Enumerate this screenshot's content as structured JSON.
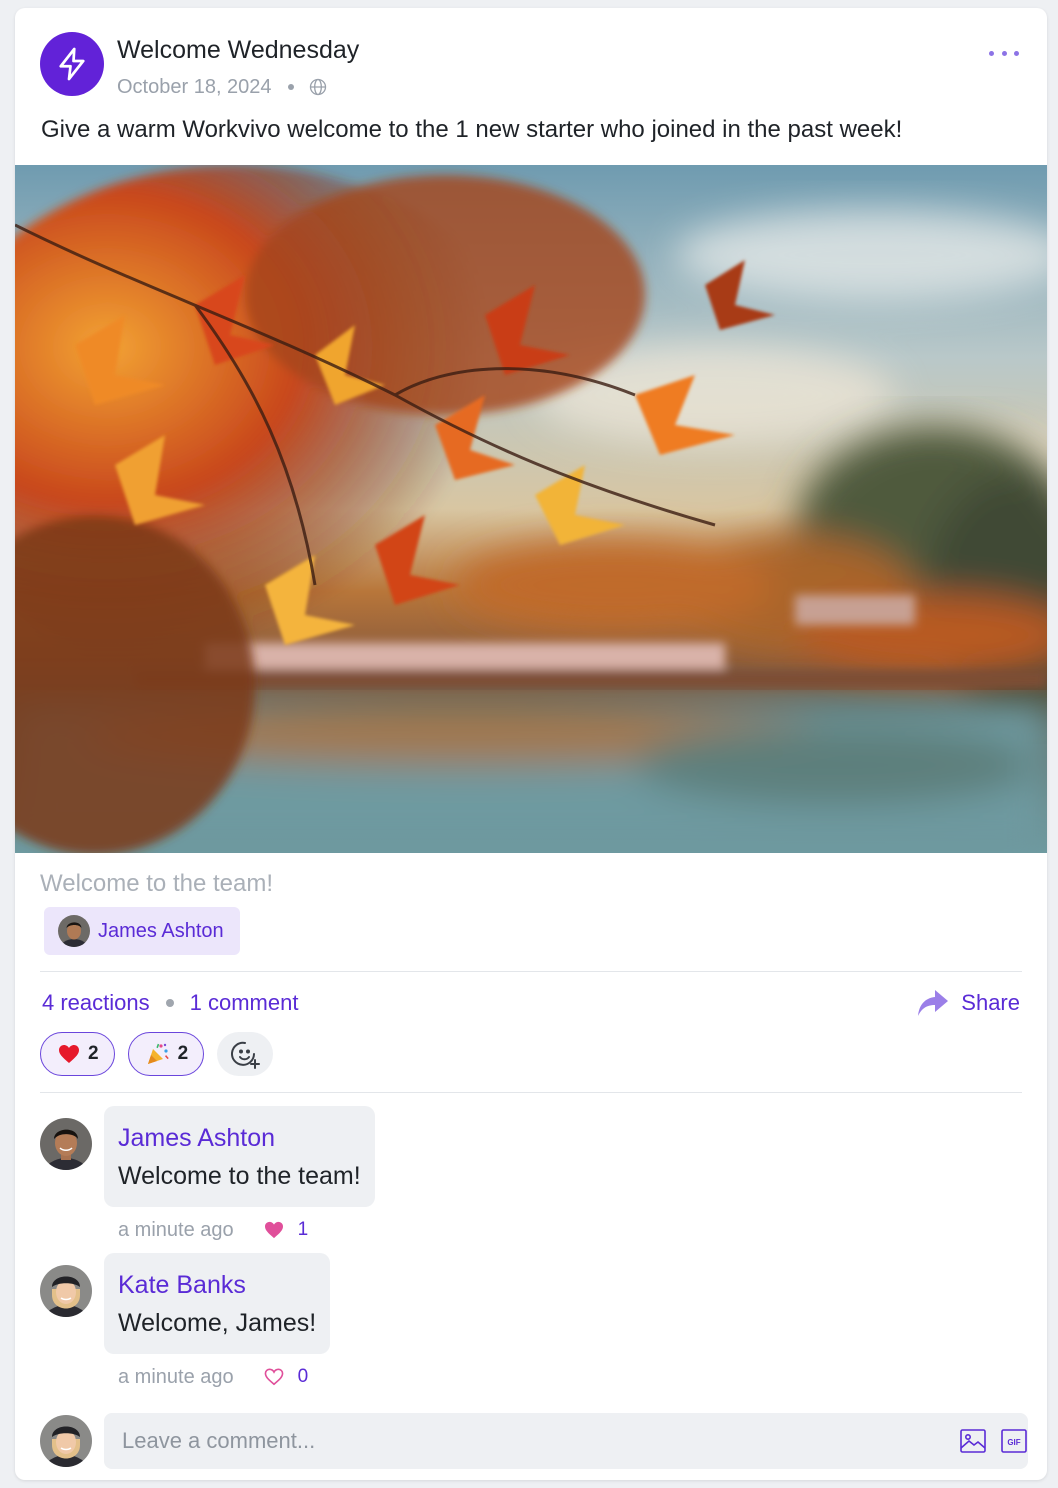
{
  "post": {
    "title": "Welcome Wednesday",
    "date": "October 18, 2024",
    "body": "Give a warm Workvivo welcome to the 1 new starter who joined in the past week!",
    "caption": "Welcome to the team!",
    "mention": "James Ashton"
  },
  "engagement": {
    "reactions_link": "4 reactions",
    "comments_link": "1 comment",
    "share_label": "Share",
    "reactions": [
      {
        "emoji": "heart",
        "count": "2"
      },
      {
        "emoji": "party-popper",
        "count": "2"
      }
    ]
  },
  "comments": [
    {
      "author": "James Ashton",
      "text": "Welcome to the team!",
      "time": "a minute ago",
      "likes": "1",
      "liked": true
    },
    {
      "author": "Kate Banks",
      "text": "Welcome, James!",
      "time": "a minute ago",
      "likes": "0",
      "liked": false
    }
  ],
  "composer": {
    "placeholder": "Leave a comment..."
  },
  "colors": {
    "accent": "#5a2bd6",
    "brand_avatar": "#6222d8",
    "like_pink": "#e04f9a"
  }
}
